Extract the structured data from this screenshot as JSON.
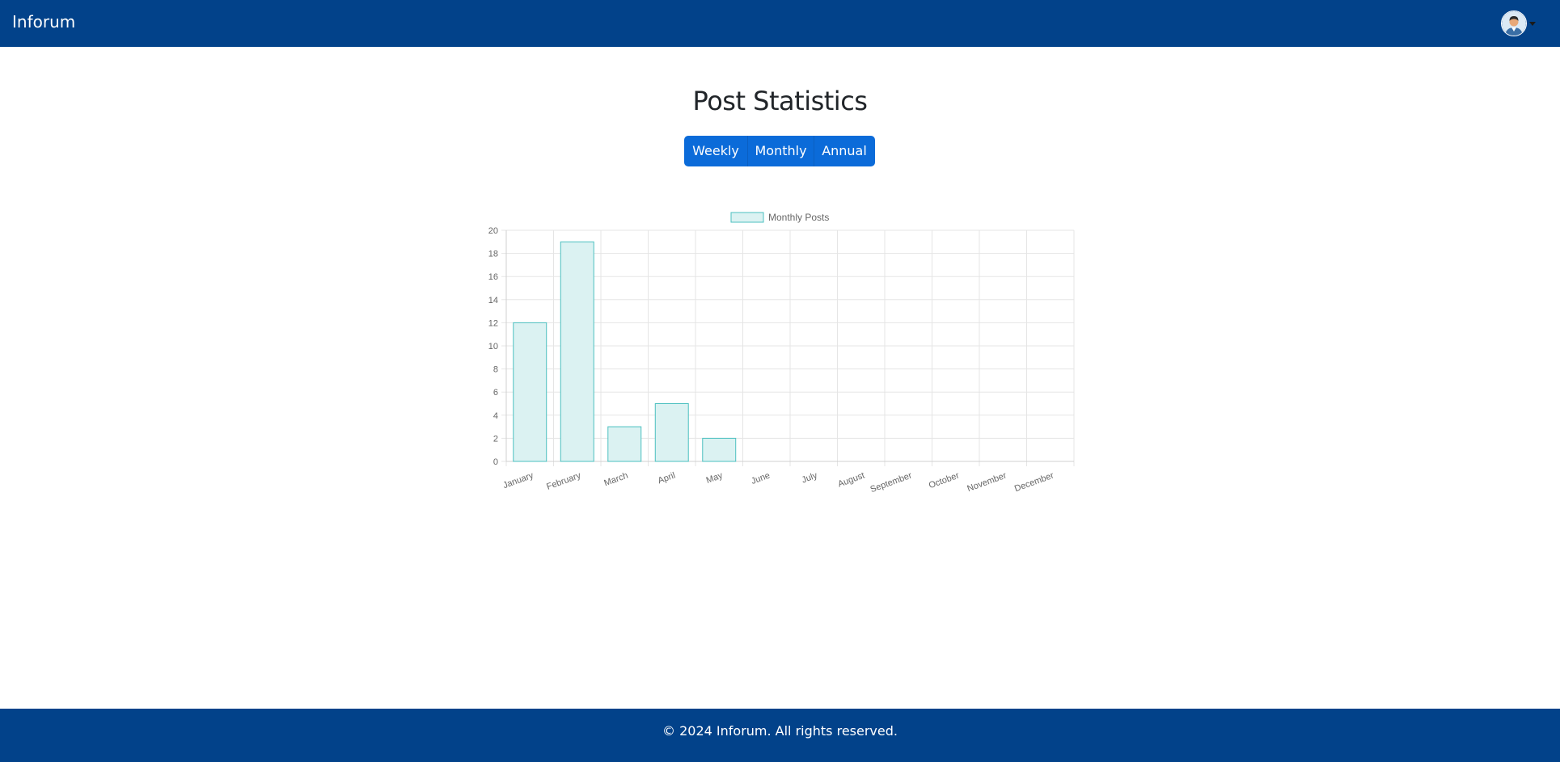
{
  "navbar": {
    "brand": "Inforum",
    "avatar_icon": "user-avatar-icon"
  },
  "page": {
    "title": "Post Statistics"
  },
  "period_buttons": {
    "weekly": "Weekly",
    "monthly": "Monthly",
    "annual": "Annual"
  },
  "chart_data": {
    "type": "bar",
    "categories": [
      "January",
      "February",
      "March",
      "April",
      "May",
      "June",
      "July",
      "August",
      "September",
      "October",
      "November",
      "December"
    ],
    "series": [
      {
        "name": "Monthly Posts",
        "values": [
          12,
          19,
          3,
          5,
          2,
          0,
          0,
          0,
          0,
          0,
          0,
          0
        ]
      }
    ],
    "title": "",
    "xlabel": "",
    "ylabel": "",
    "ylim": [
      0,
      20
    ],
    "yticks": [
      0,
      2,
      4,
      6,
      8,
      10,
      12,
      14,
      16,
      18,
      20
    ],
    "grid": true,
    "legend": "top-center",
    "colors": {
      "fill": "#dbf2f2",
      "stroke": "#4bc0c0",
      "grid": "#e5e5e5",
      "tick_text": "#666666"
    }
  },
  "footer": {
    "text": "© 2024 Inforum. All rights reserved."
  },
  "colors": {
    "navbar_bg": "#02428a",
    "button_bg": "#0b6bd9"
  }
}
